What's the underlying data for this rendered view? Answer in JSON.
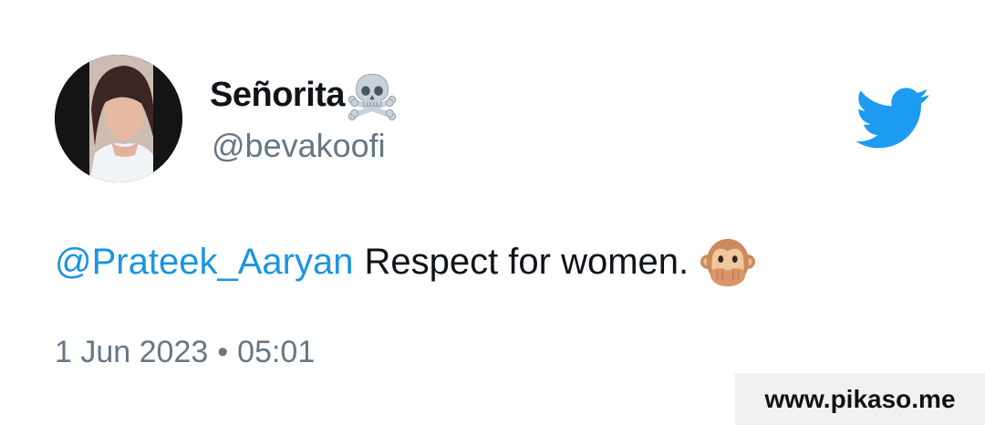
{
  "tweet": {
    "display_name": "Señorita",
    "display_name_emoji": "skull-and-crossbones-icon",
    "handle": "@bevakoofi",
    "mention": "@Prateek_Aaryan",
    "text": "Respect for women.",
    "text_emoji": "speak-no-evil-monkey-icon",
    "date": "1 Jun 2023",
    "separator": "•",
    "time": "05:01"
  },
  "brand": {
    "icon": "twitter-bird-icon",
    "color": "#1d9bf0"
  },
  "watermark": {
    "text": "www.pikaso.me"
  },
  "colors": {
    "mention": "#1b95e0",
    "secondary_text": "#657786",
    "primary_text": "#0f1419"
  }
}
